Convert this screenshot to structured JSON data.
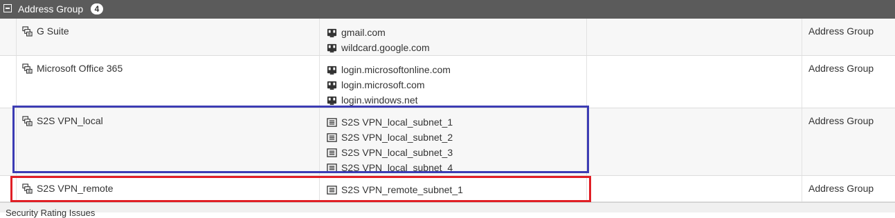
{
  "group": {
    "title": "Address Group",
    "count": "4"
  },
  "rows": [
    {
      "name": "G Suite",
      "members": [
        "gmail.com",
        "wildcard.google.com"
      ],
      "member_icon": "fqdn-icon",
      "type": "Address Group"
    },
    {
      "name": "Microsoft Office 365",
      "members": [
        "login.microsoftonline.com",
        "login.microsoft.com",
        "login.windows.net"
      ],
      "member_icon": "fqdn-icon",
      "type": "Address Group"
    },
    {
      "name": "S2S VPN_local",
      "members": [
        "S2S VPN_local_subnet_1",
        "S2S VPN_local_subnet_2",
        "S2S VPN_local_subnet_3",
        "S2S VPN_local_subnet_4"
      ],
      "member_icon": "subnet-icon",
      "type": "Address Group"
    },
    {
      "name": "S2S VPN_remote",
      "members": [
        "S2S VPN_remote_subnet_1"
      ],
      "member_icon": "subnet-icon",
      "type": "Address Group"
    }
  ],
  "footer": {
    "label": "Security Rating Issues"
  },
  "colors": {
    "header_bg": "#5b5b5b",
    "highlight_blue": "#3c3cb4",
    "highlight_red": "#e01e25"
  }
}
